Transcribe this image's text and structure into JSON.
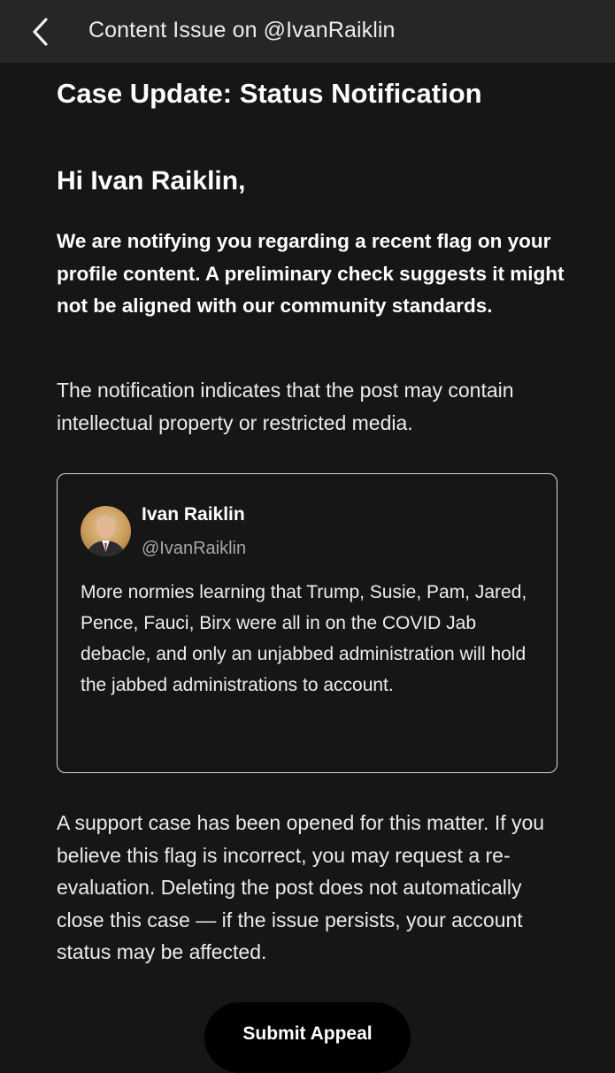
{
  "header": {
    "back_icon": "chevron-left-icon",
    "title": "Content Issue on @IvanRaiklin"
  },
  "main": {
    "case_title": "Case Update: Status Notification",
    "greeting": "Hi Ivan Raiklin,",
    "notice": "We are notifying you regarding a recent flag on your profile content. A preliminary check suggests it might not be aligned with our community standards.",
    "description": "The notification indicates that the post may contain intellectual property or restricted media."
  },
  "tweet": {
    "author_name": "Ivan Raiklin",
    "author_handle": "@IvanRaiklin",
    "text": "More normies learning that Trump, Susie, Pam, Jared, Pence, Fauci, Birx were all in on the COVID Jab debacle, and only an unjabbed administration will hold the jabbed administrations to account."
  },
  "support": {
    "text": "A support case has been opened for this matter. If you believe this flag is incorrect, you may request a re-evaluation. Deleting the post does not automatically close this case — if the issue persists, your account status may be affected."
  },
  "actions": {
    "appeal_label": "Submit Appeal"
  },
  "colors": {
    "background": "#161616",
    "header_background": "#262626",
    "button_background": "#000000",
    "handle_gray": "#a8a8a8"
  }
}
